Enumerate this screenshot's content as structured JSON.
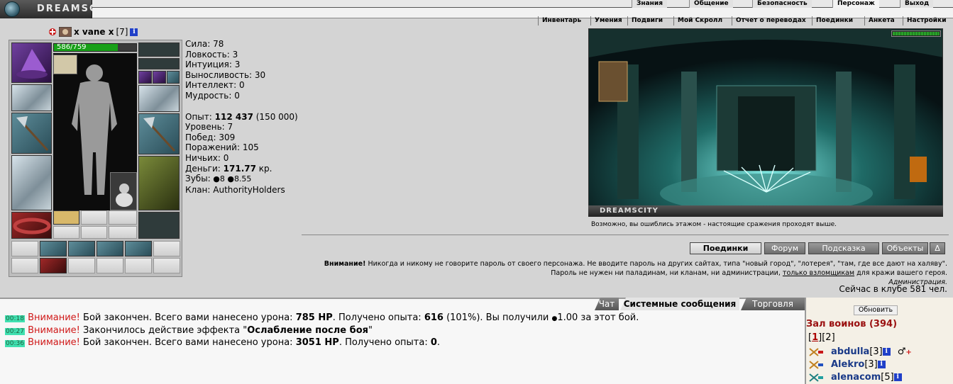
{
  "header": {
    "logo_text": "DREAMSCITY",
    "top_menu": [
      "Знания",
      "Общение",
      "Безопасность",
      "Персонаж",
      "Выход"
    ],
    "active_top": "Персонаж",
    "sub_menu": [
      "Инвентарь",
      "Умения",
      "Подвиги",
      "Мой Скролл",
      "Отчет о переводах",
      "Поединки",
      "Анкета",
      "Настройки"
    ]
  },
  "character": {
    "name": "x vane x",
    "level_badge": "[7]",
    "hp_text": "586/759",
    "hp_fraction": 0.772
  },
  "stats": {
    "strength_label": "Сила:",
    "strength": "78",
    "agility_label": "Ловкость:",
    "agility": "3",
    "intuition_label": "Интуиция:",
    "intuition": "3",
    "endurance_label": "Выносливость:",
    "endurance": "30",
    "intellect_label": "Интеллект:",
    "intellect": "0",
    "wisdom_label": "Мудрость:",
    "wisdom": "0",
    "exp_label": "Опыт:",
    "exp": "112 437",
    "exp_next": "(150 000)",
    "level_label": "Уровень:",
    "level": "7",
    "wins_label": "Побед:",
    "wins": "309",
    "losses_label": "Поражений:",
    "losses": "105",
    "draws_label": "Ничьих:",
    "draws": "0",
    "money_label": "Деньги:",
    "money": "171.77",
    "money_unit": "кр.",
    "teeth_label": "Зубы:",
    "teeth_a": "8",
    "teeth_b": "8.55",
    "clan_label": "Клан:",
    "clan": "AuthorityHolders"
  },
  "scene": {
    "footer_text": "DREAMSCITY",
    "hint": "Возможно, вы ошиблись этажом - настоящие сражения проходят выше."
  },
  "buttons": [
    "Поединки",
    "Форум",
    "Подсказка",
    "Объекты",
    "Δ"
  ],
  "selected_button": "Поединки",
  "warning": {
    "title": "Внимание!",
    "line1": "Никогда и никому не говорите пароль от своего персонажа. Не вводите пароль на других сайтах, типа \"новый город\", \"лотерея\", \"там, где все дают на халяву\".",
    "line2_a": "Пароль не нужен ни паладинам, ни кланам, ни администрации,",
    "line2_link": "только взломщикам",
    "line2_b": "для кражи вашего героя.",
    "signature": "Администрация."
  },
  "online": "Сейчас в клубе 581 чел.",
  "chat_tabs": [
    "Чат",
    "Системные сообщения",
    "Торговля"
  ],
  "selected_chat_tab": "Системные сообщения",
  "messages": [
    {
      "time": "00:18",
      "warn": "Внимание!",
      "text1": "Бой закончен. Всего вами нанесено урона:",
      "dmg": "785 HP",
      "text2": ". Получено опыта:",
      "exp": "616",
      "text3": "(101%). Вы получили",
      "coins": "1.00",
      "text4": "за этот бой."
    },
    {
      "time": "00:27",
      "warn": "Внимание!",
      "text1": "Закончилось действие эффекта \"",
      "effect": "Ослабление после боя",
      "text2": "\""
    },
    {
      "time": "00:36",
      "warn": "Внимание!",
      "text1": "Бой закончен. Всего вами нанесено урона:",
      "dmg": "3051 HP",
      "text2": ". Получено опыта:",
      "exp": "0",
      "text3": "."
    }
  ],
  "right_panel": {
    "refresh": "Обновить",
    "hall_title": "Зал воинов (394)",
    "page_cur": "1",
    "page_other": "2",
    "warriors": [
      {
        "name": "abdulla",
        "level": "[3]"
      },
      {
        "name": "Alekro",
        "level": "[3]"
      },
      {
        "name": "alenacom",
        "level": "[5]"
      }
    ]
  },
  "colors": {
    "warning_red": "#d01818",
    "hall_red": "#9a1010",
    "name_blue": "#1a3a88",
    "hp_green": "#18a018"
  }
}
